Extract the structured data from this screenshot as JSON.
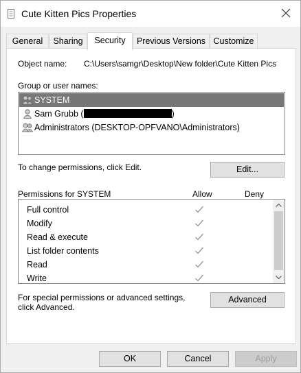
{
  "window": {
    "title": "Cute Kitten Pics Properties",
    "icons": {
      "title": "document-icon",
      "close": "close-icon"
    }
  },
  "tabs": [
    {
      "label": "General"
    },
    {
      "label": "Sharing"
    },
    {
      "label": "Security",
      "active": true
    },
    {
      "label": "Previous Versions"
    },
    {
      "label": "Customize"
    }
  ],
  "security": {
    "object_name_label": "Object name:",
    "object_name_value": "C:\\Users\\samgr\\Desktop\\New folder\\Cute Kitten Pics",
    "group_label": "Group or user names:",
    "users": [
      {
        "prefix": "SYSTEM",
        "suffix": "",
        "selected": true,
        "icon": "user-group-icon"
      },
      {
        "prefix": "Sam Grubb (",
        "suffix": ")",
        "redacted": true,
        "icon": "user-icon"
      },
      {
        "prefix": "Administrators (DESKTOP-OPFVANO\\Administrators)",
        "suffix": "",
        "icon": "user-group-icon"
      }
    ],
    "change_text": "To change permissions, click Edit.",
    "edit_button": "Edit...",
    "permissions_header": "Permissions for SYSTEM",
    "allow_header": "Allow",
    "deny_header": "Deny",
    "permissions": [
      {
        "name": "Full control",
        "allow": true,
        "deny": false
      },
      {
        "name": "Modify",
        "allow": true,
        "deny": false
      },
      {
        "name": "Read & execute",
        "allow": true,
        "deny": false
      },
      {
        "name": "List folder contents",
        "allow": true,
        "deny": false
      },
      {
        "name": "Read",
        "allow": true,
        "deny": false
      },
      {
        "name": "Write",
        "allow": true,
        "deny": false
      }
    ],
    "special_text_line1": "For special permissions or advanced settings,",
    "special_text_line2": "click Advanced.",
    "advanced_button": "Advanced"
  },
  "footer": {
    "ok": "OK",
    "cancel": "Cancel",
    "apply": "Apply",
    "apply_disabled": true
  },
  "colors": {
    "selected_row": "#777777",
    "checkmark": "#9a9a9a"
  }
}
